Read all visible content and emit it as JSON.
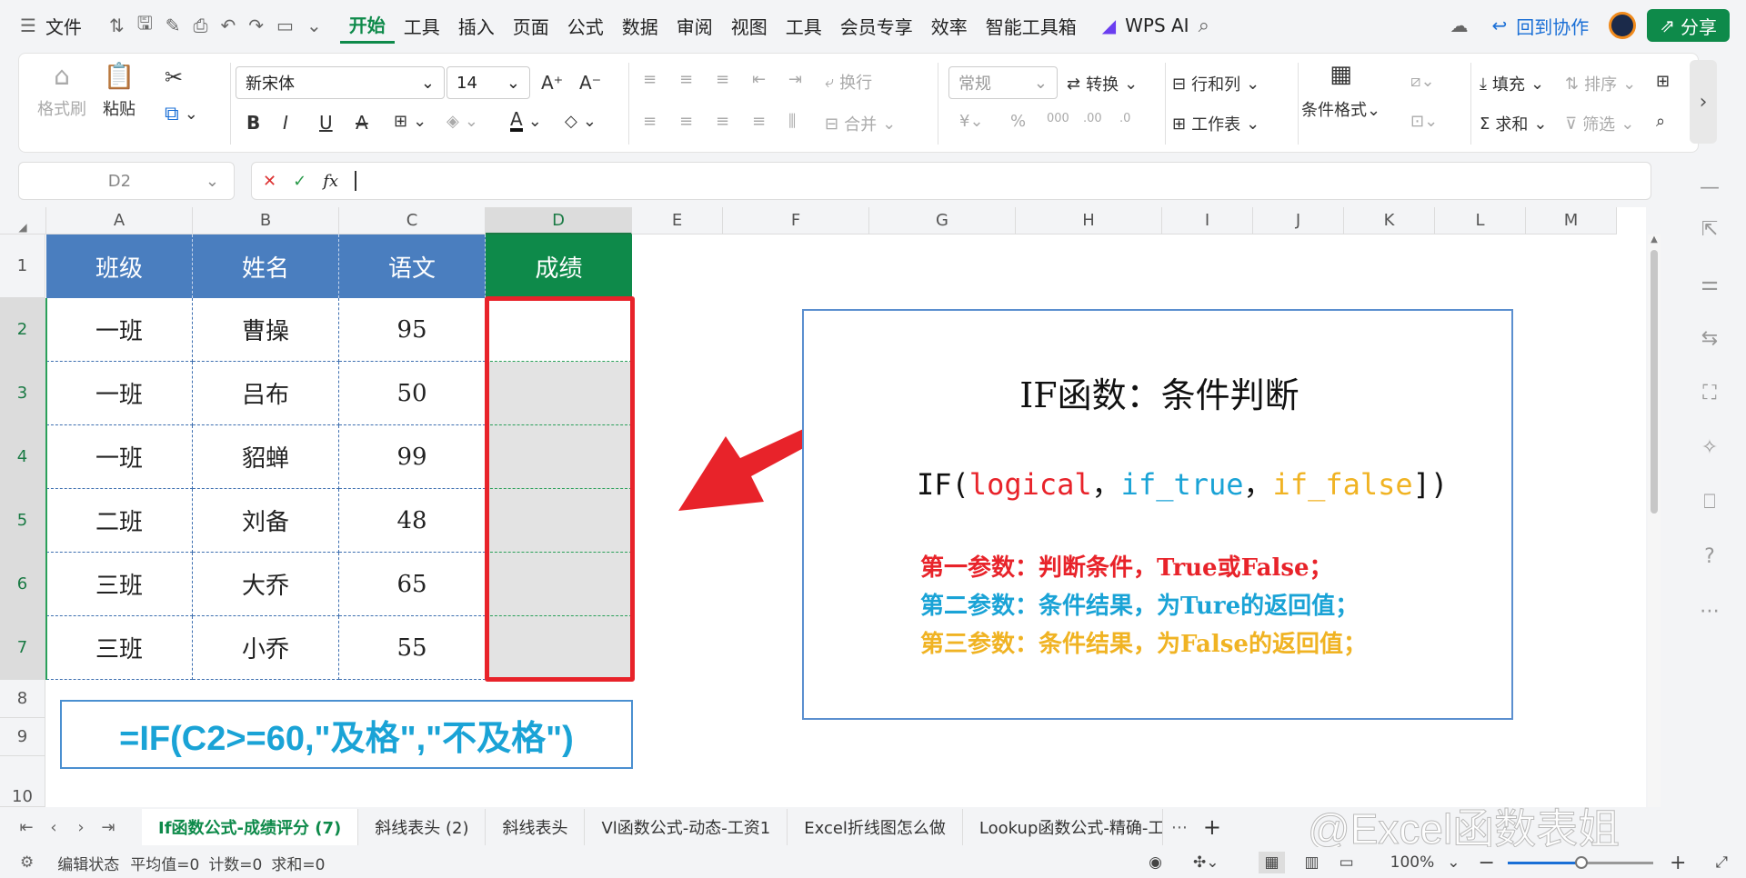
{
  "menu": {
    "file": "文件",
    "tabs": [
      "开始",
      "工具",
      "插入",
      "页面",
      "公式",
      "数据",
      "审阅",
      "视图",
      "工具",
      "会员专享",
      "效率",
      "智能工具箱"
    ],
    "ai": "WPS AI",
    "back_collab": "回到协作",
    "share": "分享"
  },
  "ribbon": {
    "format_painter": "格式刷",
    "paste": "粘贴",
    "font_name": "新宋体",
    "font_size": "14",
    "wrap": "换行",
    "number_format": "常规",
    "convert": "转换",
    "rows_cols": "行和列",
    "worksheet": "工作表",
    "cond_format": "条件格式",
    "fill": "填充",
    "sort": "排序",
    "sum": "求和",
    "filter": "筛选",
    "merge": "合并"
  },
  "formula_bar": {
    "name_box": "D2",
    "fx": "fx",
    "value": ""
  },
  "columns": [
    "A",
    "B",
    "C",
    "D",
    "E",
    "F",
    "G",
    "H",
    "I",
    "J",
    "K",
    "L",
    "M"
  ],
  "rows": [
    "1",
    "2",
    "3",
    "4",
    "5",
    "6",
    "7",
    "8",
    "9",
    "10"
  ],
  "table": {
    "headers": [
      "班级",
      "姓名",
      "语文",
      "成绩"
    ],
    "data": [
      [
        "一班",
        "曹操",
        "95",
        ""
      ],
      [
        "一班",
        "吕布",
        "50",
        ""
      ],
      [
        "一班",
        "貂蝉",
        "99",
        ""
      ],
      [
        "二班",
        "刘备",
        "48",
        ""
      ],
      [
        "三班",
        "大乔",
        "65",
        ""
      ],
      [
        "三班",
        "小乔",
        "55",
        ""
      ]
    ]
  },
  "formula_display": "=IF(C2>=60,\"及格\",\"不及格\")",
  "info_box": {
    "title": "IF函数：条件判断",
    "syntax": {
      "fn": "IF(",
      "a1": "logical",
      "c1": "，",
      "a2": "if_true",
      "c2": "，",
      "a3": "if_false",
      "close": "])"
    },
    "line1": "第一参数：判断条件，True或False；",
    "line2": "第二参数：条件结果，为Ture的返回值；",
    "line3": "第三参数：条件结果，为False的返回值；"
  },
  "sheet_tabs": [
    "If函数公式-成绩评分 (7)",
    "斜线表头 (2)",
    "斜线表头",
    "Vl函数公式-动态-工资1",
    "Excel折线图怎么做",
    "Lookup函数公式-精确-工资"
  ],
  "watermark": "@Excel函数表姐",
  "status": {
    "mode": "编辑状态",
    "avg": "平均值=0",
    "count": "计数=0",
    "sum": "求和=0",
    "zoom": "100%"
  },
  "colors": {
    "accent": "#0e8a4a",
    "header_blue": "#4a7ebf",
    "red": "#e8232a",
    "teal": "#1aa3d6",
    "gold": "#f0b323"
  }
}
